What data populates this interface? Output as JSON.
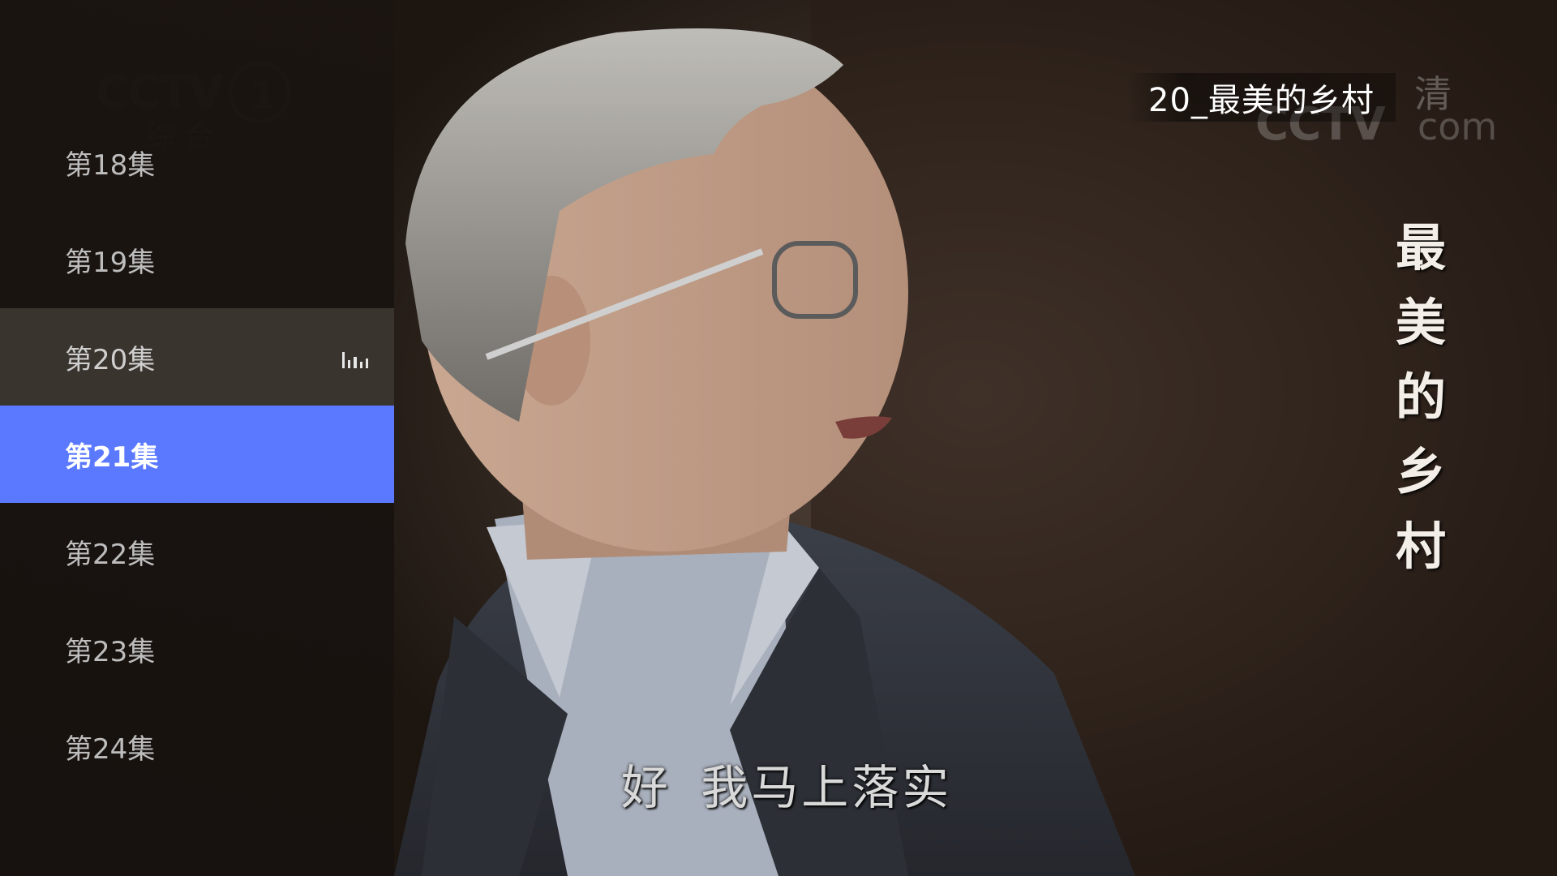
{
  "now_playing": {
    "title": "20_最美的乡村"
  },
  "watermarks": {
    "cctv1_text": "CCTV 1",
    "cctv1_sub": "综 合",
    "cctvcom_text": "CCTV.com",
    "qing": "清"
  },
  "vertical_title": [
    "最",
    "美",
    "的",
    "乡",
    "村"
  ],
  "subtitle": "好  我马上落实",
  "episodes": [
    {
      "label": "第18集",
      "state": "normal"
    },
    {
      "label": "第19集",
      "state": "normal"
    },
    {
      "label": "第20集",
      "state": "playing",
      "icon": "playing-bars-icon"
    },
    {
      "label": "第21集",
      "state": "focused"
    },
    {
      "label": "第22集",
      "state": "normal"
    },
    {
      "label": "第23集",
      "state": "normal"
    },
    {
      "label": "第24集",
      "state": "normal"
    }
  ],
  "colors": {
    "focus_accent": "#5b79ff",
    "playing_row": "#3a342f",
    "panel_bg": "#1a1410"
  }
}
